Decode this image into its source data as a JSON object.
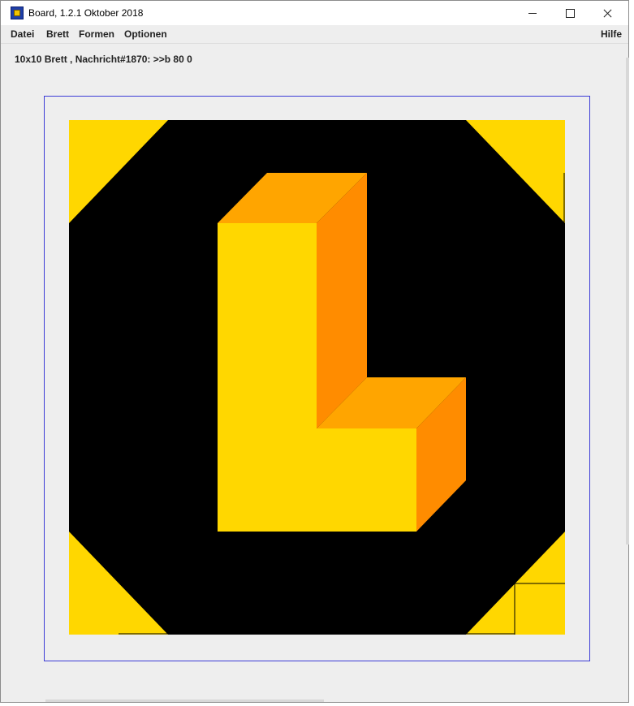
{
  "window": {
    "title": "Board, 1.2.1 Oktober 2018",
    "icon": "board-app-icon"
  },
  "menu": {
    "datei": "Datei",
    "brett": "Brett",
    "formen": "Formen",
    "optionen": "Optionen",
    "hilfe": "Hilfe"
  },
  "status": {
    "message": "10x10 Brett , Nachricht#1870: >>b 80 0"
  },
  "board": {
    "size": "10x10",
    "colors": {
      "background": "#000000",
      "yellow": "#FFD700",
      "orange_top": "#FFA500",
      "orange_side": "#FF8C00",
      "frame": "#3c3cd6"
    }
  }
}
